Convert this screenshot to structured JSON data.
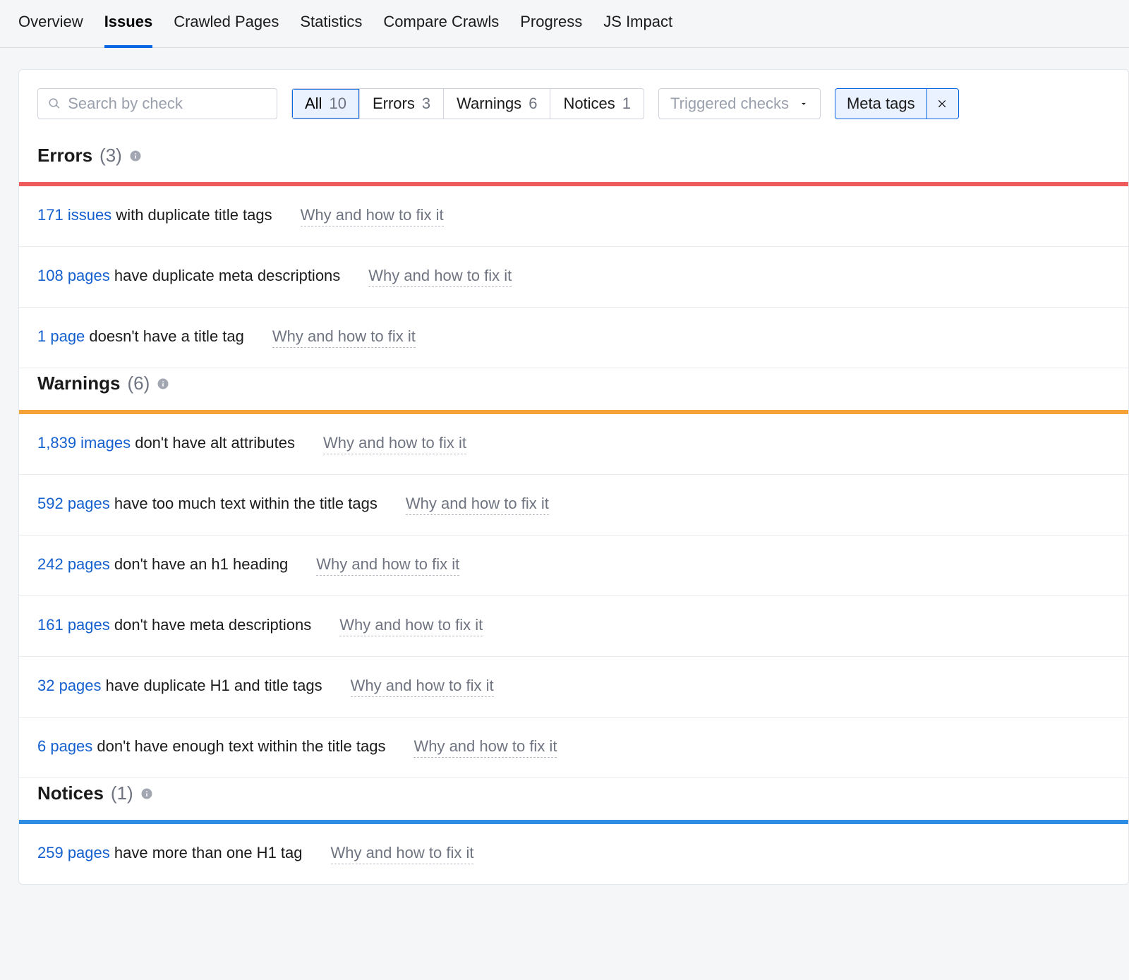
{
  "tabs": [
    {
      "label": "Overview",
      "active": false
    },
    {
      "label": "Issues",
      "active": true
    },
    {
      "label": "Crawled Pages",
      "active": false
    },
    {
      "label": "Statistics",
      "active": false
    },
    {
      "label": "Compare Crawls",
      "active": false
    },
    {
      "label": "Progress",
      "active": false
    },
    {
      "label": "JS Impact",
      "active": false
    }
  ],
  "toolbar": {
    "search_placeholder": "Search by check",
    "filters": [
      {
        "label": "All",
        "count": 10,
        "active": true
      },
      {
        "label": "Errors",
        "count": 3,
        "active": false
      },
      {
        "label": "Warnings",
        "count": 6,
        "active": false
      },
      {
        "label": "Notices",
        "count": 1,
        "active": false
      }
    ],
    "dropdown_label": "Triggered checks",
    "chip_label": "Meta tags"
  },
  "sections": [
    {
      "title": "Errors",
      "count": "(3)",
      "ruleClass": "err",
      "rows": [
        {
          "link": "171 issues",
          "suffix": " with duplicate title tags",
          "why": "Why and how to fix it"
        },
        {
          "link": "108 pages",
          "suffix": " have duplicate meta descriptions",
          "why": "Why and how to fix it"
        },
        {
          "link": "1 page",
          "suffix": " doesn't have a title tag",
          "why": "Why and how to fix it"
        }
      ]
    },
    {
      "title": "Warnings",
      "count": "(6)",
      "ruleClass": "warn",
      "rows": [
        {
          "link": "1,839 images",
          "suffix": " don't have alt attributes",
          "why": "Why and how to fix it"
        },
        {
          "link": "592 pages",
          "suffix": " have too much text within the title tags",
          "why": "Why and how to fix it"
        },
        {
          "link": "242 pages",
          "suffix": " don't have an h1 heading",
          "why": "Why and how to fix it"
        },
        {
          "link": "161 pages",
          "suffix": " don't have meta descriptions",
          "why": "Why and how to fix it"
        },
        {
          "link": "32 pages",
          "suffix": " have duplicate H1 and title tags",
          "why": "Why and how to fix it"
        },
        {
          "link": "6 pages",
          "suffix": " don't have enough text within the title tags",
          "why": "Why and how to fix it"
        }
      ]
    },
    {
      "title": "Notices",
      "count": "(1)",
      "ruleClass": "not",
      "rows": [
        {
          "link": "259 pages",
          "suffix": " have more than one H1 tag",
          "why": "Why and how to fix it"
        }
      ]
    }
  ]
}
